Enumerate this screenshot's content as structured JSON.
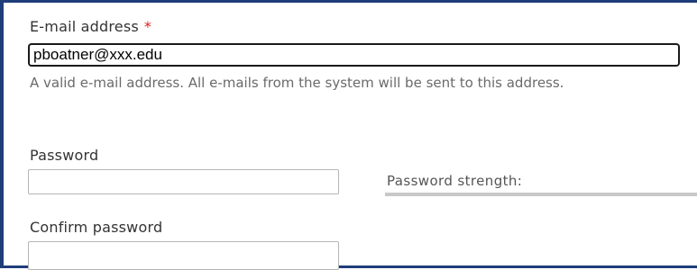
{
  "email": {
    "label": "E-mail address",
    "required_marker": "*",
    "value": "pboatner@xxx.edu",
    "description": "A valid e-mail address. All e-mails from the system will be sent to this address."
  },
  "password": {
    "label": "Password",
    "value": "",
    "strength_label": "Password strength:"
  },
  "confirm_password": {
    "label": "Confirm password",
    "value": ""
  },
  "colors": {
    "frame_border": "#1f3d7a",
    "required_marker": "#e02020",
    "description_text": "#6a6a6a"
  }
}
